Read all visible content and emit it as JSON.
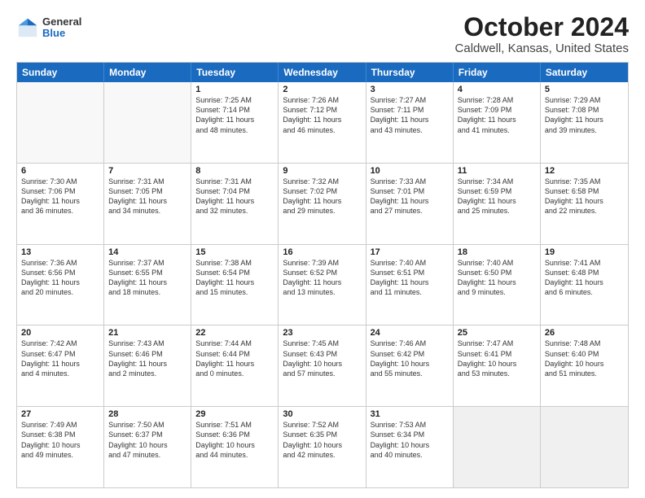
{
  "logo": {
    "general": "General",
    "blue": "Blue"
  },
  "title": "October 2024",
  "subtitle": "Caldwell, Kansas, United States",
  "headers": [
    "Sunday",
    "Monday",
    "Tuesday",
    "Wednesday",
    "Thursday",
    "Friday",
    "Saturday"
  ],
  "rows": [
    [
      {
        "day": "",
        "text": "",
        "empty": true
      },
      {
        "day": "",
        "text": "",
        "empty": true
      },
      {
        "day": "1",
        "text": "Sunrise: 7:25 AM\nSunset: 7:14 PM\nDaylight: 11 hours\nand 48 minutes."
      },
      {
        "day": "2",
        "text": "Sunrise: 7:26 AM\nSunset: 7:12 PM\nDaylight: 11 hours\nand 46 minutes."
      },
      {
        "day": "3",
        "text": "Sunrise: 7:27 AM\nSunset: 7:11 PM\nDaylight: 11 hours\nand 43 minutes."
      },
      {
        "day": "4",
        "text": "Sunrise: 7:28 AM\nSunset: 7:09 PM\nDaylight: 11 hours\nand 41 minutes."
      },
      {
        "day": "5",
        "text": "Sunrise: 7:29 AM\nSunset: 7:08 PM\nDaylight: 11 hours\nand 39 minutes."
      }
    ],
    [
      {
        "day": "6",
        "text": "Sunrise: 7:30 AM\nSunset: 7:06 PM\nDaylight: 11 hours\nand 36 minutes."
      },
      {
        "day": "7",
        "text": "Sunrise: 7:31 AM\nSunset: 7:05 PM\nDaylight: 11 hours\nand 34 minutes."
      },
      {
        "day": "8",
        "text": "Sunrise: 7:31 AM\nSunset: 7:04 PM\nDaylight: 11 hours\nand 32 minutes."
      },
      {
        "day": "9",
        "text": "Sunrise: 7:32 AM\nSunset: 7:02 PM\nDaylight: 11 hours\nand 29 minutes."
      },
      {
        "day": "10",
        "text": "Sunrise: 7:33 AM\nSunset: 7:01 PM\nDaylight: 11 hours\nand 27 minutes."
      },
      {
        "day": "11",
        "text": "Sunrise: 7:34 AM\nSunset: 6:59 PM\nDaylight: 11 hours\nand 25 minutes."
      },
      {
        "day": "12",
        "text": "Sunrise: 7:35 AM\nSunset: 6:58 PM\nDaylight: 11 hours\nand 22 minutes."
      }
    ],
    [
      {
        "day": "13",
        "text": "Sunrise: 7:36 AM\nSunset: 6:56 PM\nDaylight: 11 hours\nand 20 minutes."
      },
      {
        "day": "14",
        "text": "Sunrise: 7:37 AM\nSunset: 6:55 PM\nDaylight: 11 hours\nand 18 minutes."
      },
      {
        "day": "15",
        "text": "Sunrise: 7:38 AM\nSunset: 6:54 PM\nDaylight: 11 hours\nand 15 minutes."
      },
      {
        "day": "16",
        "text": "Sunrise: 7:39 AM\nSunset: 6:52 PM\nDaylight: 11 hours\nand 13 minutes."
      },
      {
        "day": "17",
        "text": "Sunrise: 7:40 AM\nSunset: 6:51 PM\nDaylight: 11 hours\nand 11 minutes."
      },
      {
        "day": "18",
        "text": "Sunrise: 7:40 AM\nSunset: 6:50 PM\nDaylight: 11 hours\nand 9 minutes."
      },
      {
        "day": "19",
        "text": "Sunrise: 7:41 AM\nSunset: 6:48 PM\nDaylight: 11 hours\nand 6 minutes."
      }
    ],
    [
      {
        "day": "20",
        "text": "Sunrise: 7:42 AM\nSunset: 6:47 PM\nDaylight: 11 hours\nand 4 minutes."
      },
      {
        "day": "21",
        "text": "Sunrise: 7:43 AM\nSunset: 6:46 PM\nDaylight: 11 hours\nand 2 minutes."
      },
      {
        "day": "22",
        "text": "Sunrise: 7:44 AM\nSunset: 6:44 PM\nDaylight: 11 hours\nand 0 minutes."
      },
      {
        "day": "23",
        "text": "Sunrise: 7:45 AM\nSunset: 6:43 PM\nDaylight: 10 hours\nand 57 minutes."
      },
      {
        "day": "24",
        "text": "Sunrise: 7:46 AM\nSunset: 6:42 PM\nDaylight: 10 hours\nand 55 minutes."
      },
      {
        "day": "25",
        "text": "Sunrise: 7:47 AM\nSunset: 6:41 PM\nDaylight: 10 hours\nand 53 minutes."
      },
      {
        "day": "26",
        "text": "Sunrise: 7:48 AM\nSunset: 6:40 PM\nDaylight: 10 hours\nand 51 minutes."
      }
    ],
    [
      {
        "day": "27",
        "text": "Sunrise: 7:49 AM\nSunset: 6:38 PM\nDaylight: 10 hours\nand 49 minutes."
      },
      {
        "day": "28",
        "text": "Sunrise: 7:50 AM\nSunset: 6:37 PM\nDaylight: 10 hours\nand 47 minutes."
      },
      {
        "day": "29",
        "text": "Sunrise: 7:51 AM\nSunset: 6:36 PM\nDaylight: 10 hours\nand 44 minutes."
      },
      {
        "day": "30",
        "text": "Sunrise: 7:52 AM\nSunset: 6:35 PM\nDaylight: 10 hours\nand 42 minutes."
      },
      {
        "day": "31",
        "text": "Sunrise: 7:53 AM\nSunset: 6:34 PM\nDaylight: 10 hours\nand 40 minutes."
      },
      {
        "day": "",
        "text": "",
        "empty": true,
        "shaded": true
      },
      {
        "day": "",
        "text": "",
        "empty": true,
        "shaded": true
      }
    ]
  ]
}
